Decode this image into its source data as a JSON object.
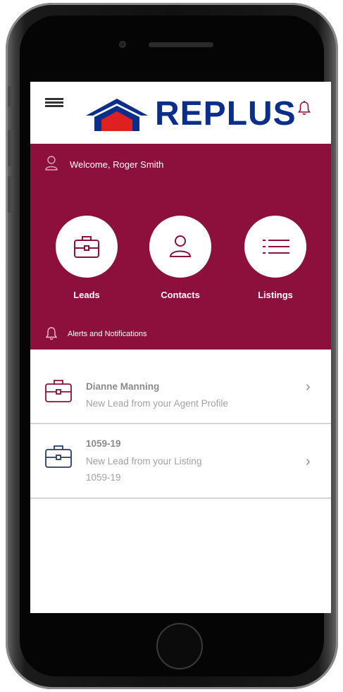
{
  "header": {
    "brand": "REPLUS",
    "menu_icon": "hamburger-menu-icon",
    "notification_icon": "bell-icon"
  },
  "welcome": {
    "text": "Welcome, Roger Smith",
    "icon": "user-icon"
  },
  "quick_actions": [
    {
      "label": "Leads",
      "icon": "briefcase-icon"
    },
    {
      "label": "Contacts",
      "icon": "person-icon"
    },
    {
      "label": "Listings",
      "icon": "list-icon"
    }
  ],
  "alerts_label": "Alerts and Notifications",
  "notifications": [
    {
      "title": "Dianne Manning",
      "line1": "New Lead from your Agent Profile",
      "line2": "",
      "icon": "briefcase-icon",
      "icon_color": "#8d0f3b"
    },
    {
      "title": "1059-19",
      "line1": "New Lead from your Listing",
      "line2": "1059-19",
      "icon": "briefcase-icon",
      "icon_color": "#2b3a67"
    }
  ],
  "colors": {
    "brand_primary": "#8d0f3b",
    "logo_blue": "#0a2e8a",
    "logo_red": "#e02020"
  }
}
